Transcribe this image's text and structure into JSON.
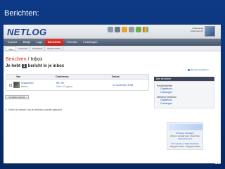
{
  "slide": {
    "title": "Berichten:",
    "page_number": "12"
  },
  "header": {
    "logo_text": "NETLOG",
    "user_line_1": "[Username]",
    "user_line_2": "[Username] ▾"
  },
  "nav": {
    "items": [
      "Explore",
      "Bekijk",
      "Logs",
      "Berichten",
      "Vrienden",
      "Instellingen"
    ]
  },
  "subnav": {
    "items": [
      "Inbox",
      "Verstuurd",
      "Prullenbak",
      "Nieuw bericht"
    ]
  },
  "page": {
    "breadcrumb": "Berichten",
    "breadcrumb_sep": "/",
    "section": "Inbox",
    "subtitle_pre": "Je hebt",
    "unread_count": "1",
    "subtitle_post": "bericht in je inbox",
    "top_link": "Bericht verwijderen"
  },
  "table": {
    "headers": [
      "Van",
      "Onderwerp",
      "Datum"
    ],
    "rows": [
      {
        "user_name": "Uniqueuser",
        "user_status": "Nieuw",
        "subject": "RE: Hi!",
        "subject_sub": "View 1/1 (gnw)",
        "date": "13 november 2008"
      }
    ]
  },
  "buttons": {
    "delete": "Verwijder selectie"
  },
  "footer_note": "Enkel de namen van je vrienden worden getoond",
  "sidebar": {
    "header": "Alle berichten",
    "section_1": "Privéberichten",
    "links_1": [
      "Ongelezen",
      "Ontvangen"
    ],
    "section_2": "Netwerk berichten",
    "links_2": [
      "Ongelezen",
      "Ontvangen"
    ]
  },
  "ad": {
    "title": "ICTmeet Company",
    "text": "Ad text, spread over a few lines",
    "link": "www.ictmeet.nl",
    "title_2": "ICT meets en Vrijheidstweets",
    "text_2": "Nog geen tekst.. Nog geen tekst"
  },
  "colors": {
    "slide_bg": "#0a2c6c",
    "nav_active": "#d2261c",
    "link": "#1b56b5"
  }
}
